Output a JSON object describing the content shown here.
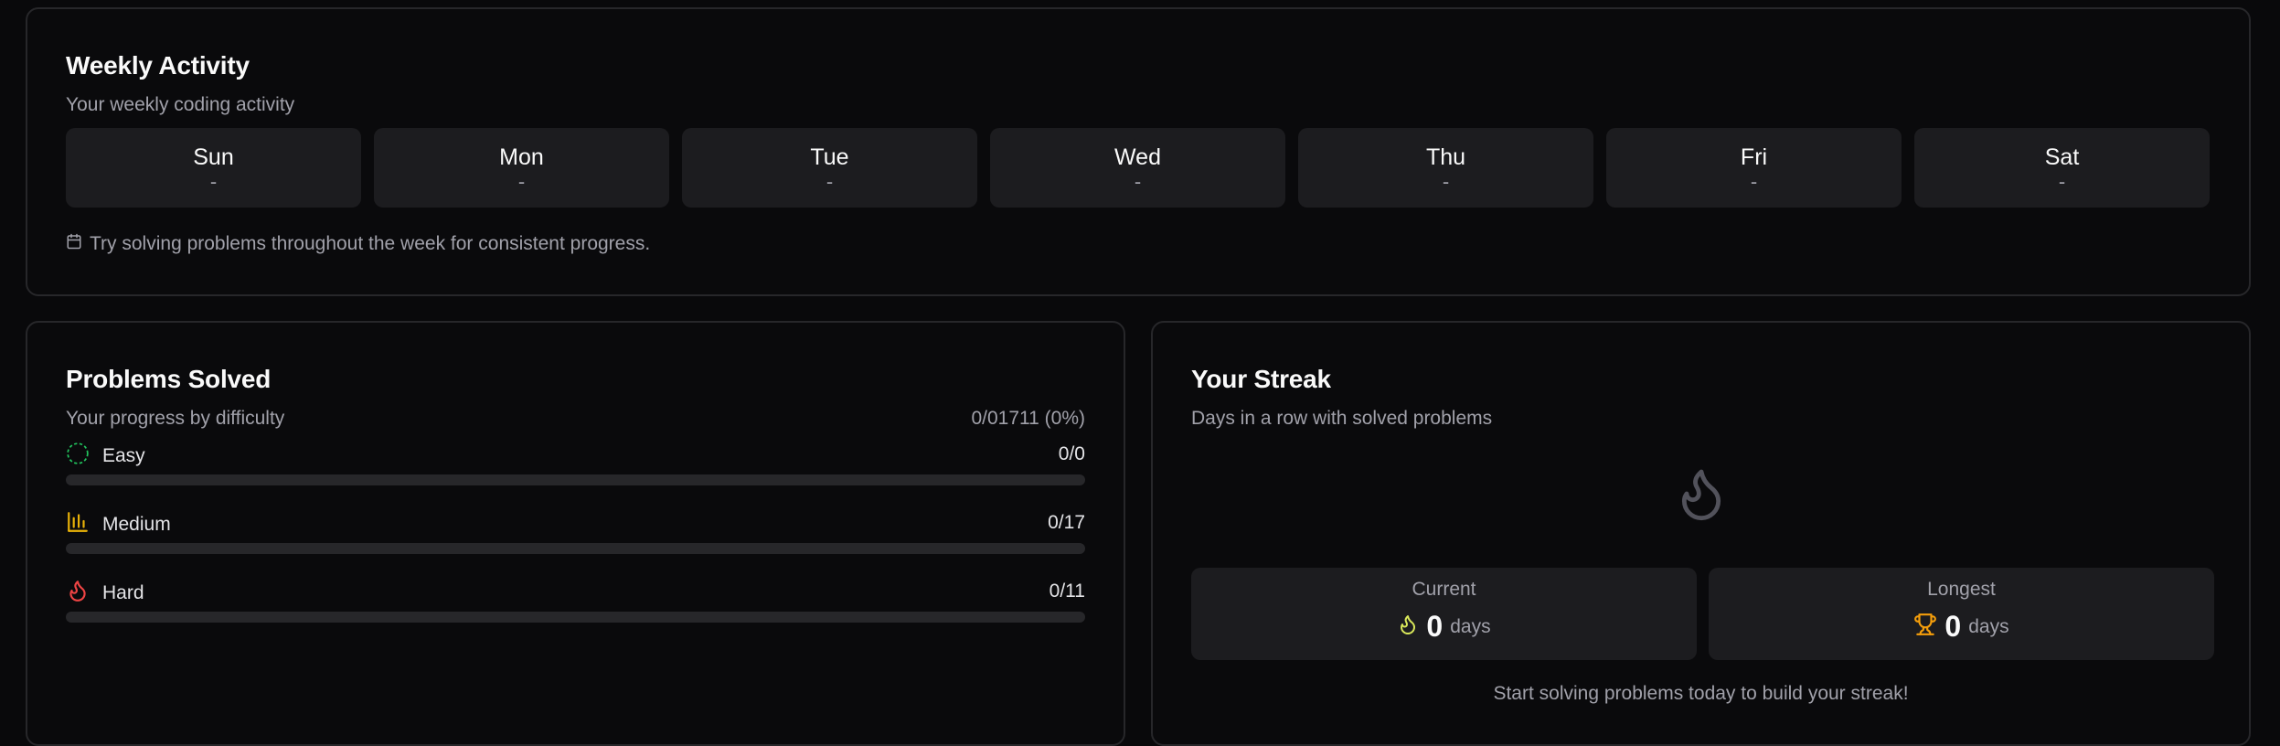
{
  "weekly": {
    "title": "Weekly Activity",
    "subtitle": "Your weekly coding activity",
    "days": [
      {
        "name": "Sun",
        "value": "-"
      },
      {
        "name": "Mon",
        "value": "-"
      },
      {
        "name": "Tue",
        "value": "-"
      },
      {
        "name": "Wed",
        "value": "-"
      },
      {
        "name": "Thu",
        "value": "-"
      },
      {
        "name": "Fri",
        "value": "-"
      },
      {
        "name": "Sat",
        "value": "-"
      }
    ],
    "tip": "Try solving problems throughout the week for consistent progress.",
    "tip_icon": "calendar-icon"
  },
  "problems": {
    "title": "Problems Solved",
    "subtitle": "Your progress by difficulty",
    "total": "0/01711 (0%)",
    "rows": [
      {
        "label": "Easy",
        "count": "0/0",
        "progress": 0,
        "icon": "dashed-circle-icon",
        "color": "#22c55e"
      },
      {
        "label": "Medium",
        "count": "0/17",
        "progress": 0,
        "icon": "bar-chart-icon",
        "color": "#eab308"
      },
      {
        "label": "Hard",
        "count": "0/11",
        "progress": 0,
        "icon": "flame-icon",
        "color": "#ef4444"
      }
    ]
  },
  "streak": {
    "title": "Your Streak",
    "subtitle": "Days in a row with solved problems",
    "hero_icon": "flame-icon",
    "current": {
      "label": "Current",
      "value": "0",
      "unit": "days",
      "icon": "flame-icon",
      "color": "#d9e85a"
    },
    "longest": {
      "label": "Longest",
      "value": "0",
      "unit": "days",
      "icon": "trophy-icon",
      "color": "#f59e0b"
    },
    "footer": "Start solving problems today to build your streak!"
  }
}
